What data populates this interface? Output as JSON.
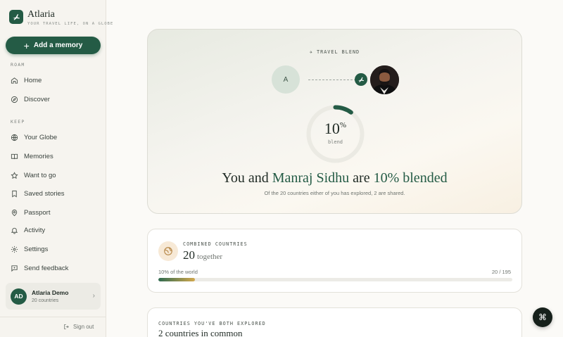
{
  "brand": {
    "name": "Atlaria",
    "tagline": "YOUR TRAVEL LIFE, ON A GLOBE"
  },
  "sidebar": {
    "add_button": "Add a memory",
    "sections": [
      {
        "label": "ROAM",
        "items": [
          {
            "label": "Home",
            "icon": "home-icon"
          },
          {
            "label": "Discover",
            "icon": "compass-icon"
          }
        ]
      },
      {
        "label": "KEEP",
        "items": [
          {
            "label": "Your Globe",
            "icon": "globe-icon"
          },
          {
            "label": "Memories",
            "icon": "book-icon"
          },
          {
            "label": "Want to go",
            "icon": "star-icon"
          },
          {
            "label": "Saved stories",
            "icon": "bookmark-icon"
          },
          {
            "label": "Passport",
            "icon": "location-pin-icon"
          },
          {
            "label": "Activity",
            "icon": "bell-icon"
          },
          {
            "label": "Settings",
            "icon": "gear-icon"
          },
          {
            "label": "Send feedback",
            "icon": "feedback-icon"
          }
        ]
      }
    ],
    "user": {
      "initials": "AD",
      "name": "Atlaria Demo",
      "subtitle": "20 countries"
    },
    "sign_out": "Sign out"
  },
  "blend": {
    "label": "TRAVEL BLEND",
    "my_initial": "A",
    "percent_value": "10",
    "percent_sign": "%",
    "percent_fraction": 0.1,
    "gauge_caption": "blend",
    "headline": {
      "pre": "You and ",
      "name": "Manraj Sidhu",
      "mid": " are ",
      "result": "10% blended"
    },
    "subline": "Of the 20 countries either of you has explored, 2 are shared."
  },
  "combined": {
    "label": "COMBINED COUNTRIES",
    "value": "20",
    "suffix": "together",
    "world_text": "10% of the world",
    "count_text": "20 / 195",
    "progress": 0.1026
  },
  "common": {
    "label": "COUNTRIES YOU'VE BOTH EXPLORED",
    "value": "2 countries in common"
  },
  "colors": {
    "accent": "#245b45",
    "gold": "#d2a84e",
    "background": "#fbfaf7"
  }
}
